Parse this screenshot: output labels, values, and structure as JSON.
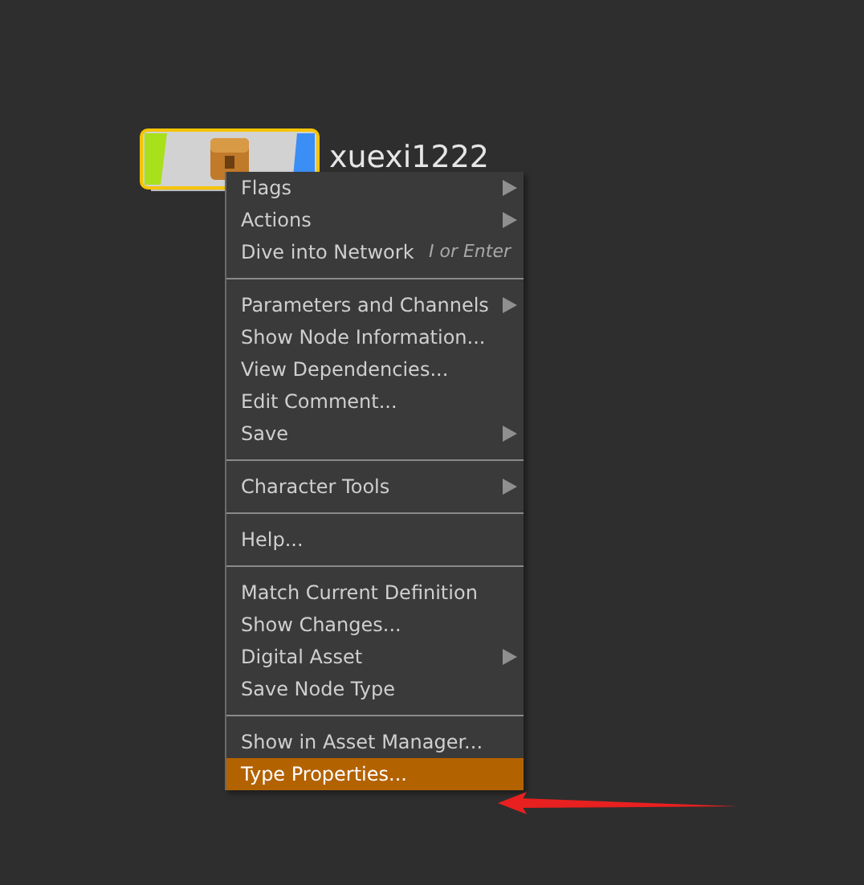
{
  "node": {
    "label": "xuexi1222",
    "selected": true
  },
  "context_menu": {
    "groups": [
      [
        {
          "label": "Flags",
          "submenu": true,
          "selected": false
        },
        {
          "label": "Actions",
          "submenu": true,
          "selected": false
        },
        {
          "label": "Dive into Network",
          "shortcut": "I or Enter",
          "submenu": false,
          "selected": false
        }
      ],
      [
        {
          "label": "Parameters and Channels",
          "submenu": true,
          "selected": false
        },
        {
          "label": "Show Node Information...",
          "submenu": false,
          "selected": false
        },
        {
          "label": "View Dependencies...",
          "submenu": false,
          "selected": false
        },
        {
          "label": "Edit Comment...",
          "submenu": false,
          "selected": false
        },
        {
          "label": "Save",
          "submenu": true,
          "selected": false
        }
      ],
      [
        {
          "label": "Character Tools",
          "submenu": true,
          "selected": false
        }
      ],
      [
        {
          "label": "Help...",
          "submenu": false,
          "selected": false
        }
      ],
      [
        {
          "label": "Match Current Definition",
          "submenu": false,
          "selected": false
        },
        {
          "label": "Show Changes...",
          "submenu": false,
          "selected": false
        },
        {
          "label": "Digital Asset",
          "submenu": true,
          "selected": false
        },
        {
          "label": "Save Node Type",
          "submenu": false,
          "selected": false
        }
      ],
      [
        {
          "label": "Show in Asset Manager...",
          "submenu": false,
          "selected": false
        },
        {
          "label": "Type Properties...",
          "submenu": false,
          "selected": true
        }
      ]
    ]
  }
}
